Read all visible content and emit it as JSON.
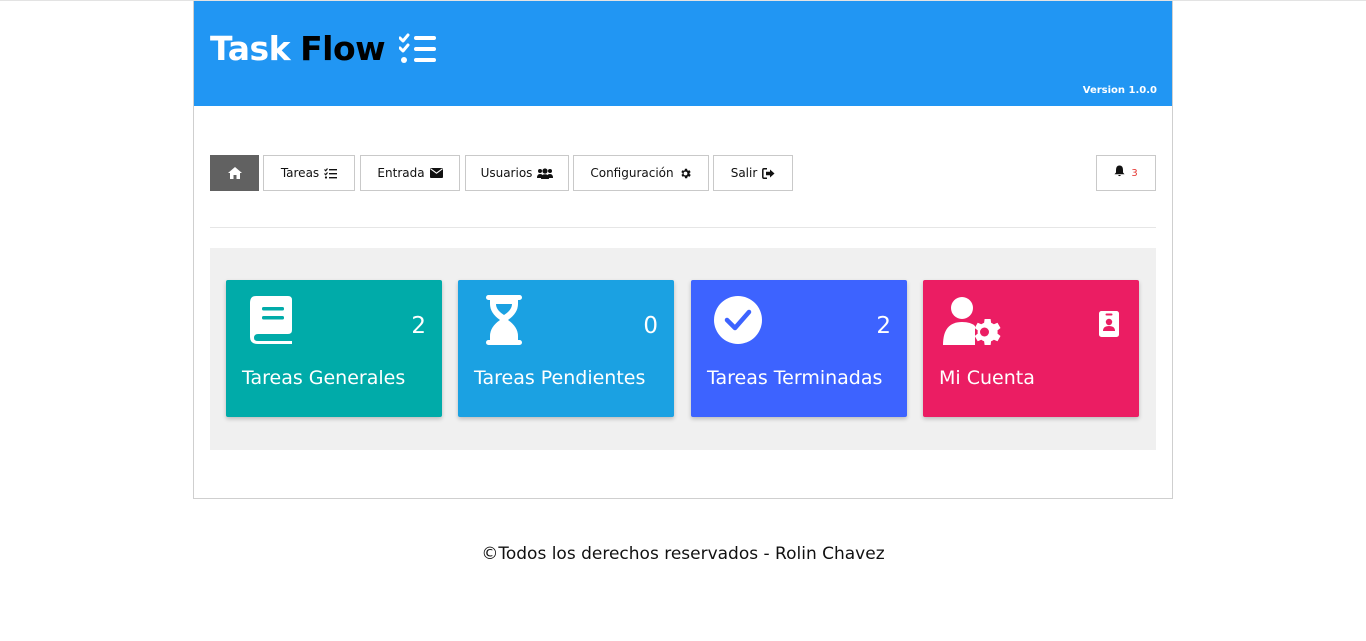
{
  "header": {
    "title_part1": "Task",
    "title_part2": "Flow",
    "logo_icon": "checklist-icon",
    "version": "Version 1.0.0",
    "background": "#2196f3"
  },
  "nav": {
    "home_icon": "home-icon",
    "items": [
      {
        "label": "Tareas",
        "icon": "checklist-icon"
      },
      {
        "label": "Entrada",
        "icon": "envelope-icon"
      },
      {
        "label": "Usuarios",
        "icon": "users-icon"
      },
      {
        "label": "Configuración",
        "icon": "gear-icon"
      },
      {
        "label": "Salir",
        "icon": "sign-out-icon"
      }
    ],
    "notifications": {
      "icon": "bell-icon",
      "count": "3"
    }
  },
  "cards": [
    {
      "label": "Tareas Generales",
      "count": "2",
      "icon": "book-icon",
      "color": "#00aba9"
    },
    {
      "label": "Tareas Pendientes",
      "count": "0",
      "icon": "hourglass-icon",
      "color": "#1ba1e2"
    },
    {
      "label": "Tareas Terminadas",
      "count": "2",
      "icon": "check-circle-icon",
      "color": "#3d63ff"
    },
    {
      "label": "Mi Cuenta",
      "count": "",
      "icon": "user-gear-icon",
      "side_icon": "id-badge-icon",
      "color": "#eb1d63"
    }
  ],
  "footer": {
    "text": "©Todos los derechos reservados - Rolin Chavez"
  }
}
